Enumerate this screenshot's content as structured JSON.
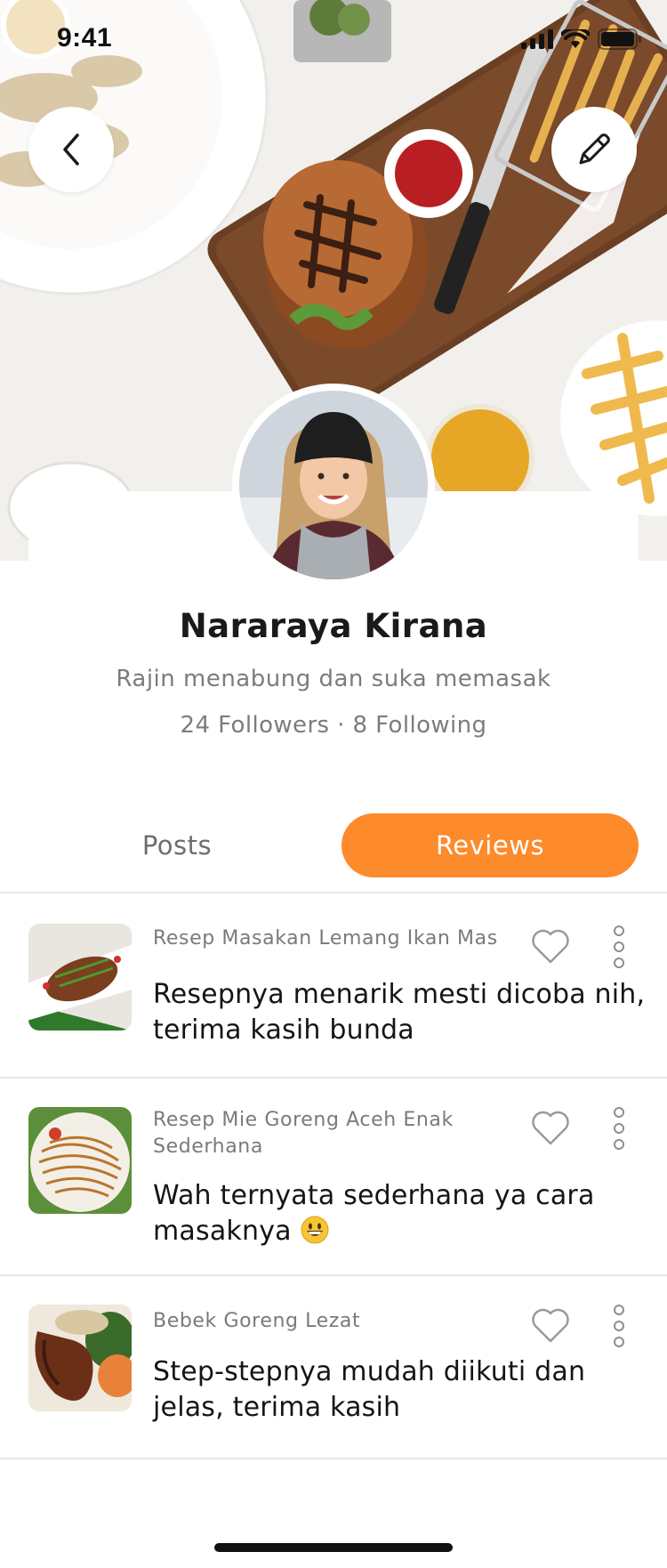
{
  "status_bar": {
    "time": "9:41"
  },
  "profile": {
    "name": "Nararaya Kirana",
    "bio": "Rajin menabung dan suka memasak",
    "stats": "24 Followers · 8 Following"
  },
  "tabs": [
    {
      "label": "Posts",
      "active": false
    },
    {
      "label": "Reviews",
      "active": true
    }
  ],
  "reviews": [
    {
      "recipe": "Resep Masakan Lemang Ikan Mas",
      "comment": "Resepnya menarik mesti dicoba nih, terima kasih bunda",
      "emoji": false
    },
    {
      "recipe": "Resep Mie Goreng Aceh Enak Sederhana",
      "comment": "Wah ternyata sederhana ya cara masaknya",
      "emoji": true
    },
    {
      "recipe": "Bebek Goreng Lezat",
      "comment": "Step-stepnya mudah diikuti dan jelas, terima kasih",
      "emoji": false
    }
  ],
  "colors": {
    "accent": "#fd8a2b",
    "text": "#151515",
    "muted": "#7a7a7a",
    "divider": "#e6e6e6"
  },
  "icons": [
    "chevron-left-icon",
    "pencil-icon",
    "heart-icon",
    "more-vertical-icon",
    "signal-icon",
    "wifi-icon",
    "battery-icon"
  ]
}
